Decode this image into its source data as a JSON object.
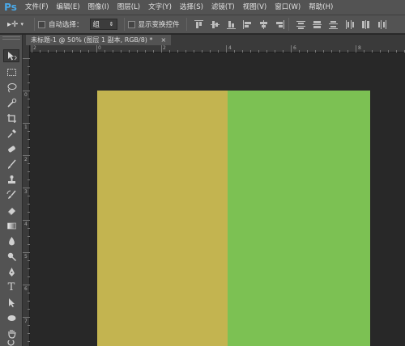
{
  "app": {
    "logo": "Ps",
    "menu": [
      "文件(F)",
      "编辑(E)",
      "图像(I)",
      "图层(L)",
      "文字(Y)",
      "选择(S)",
      "滤镜(T)",
      "视图(V)",
      "窗口(W)",
      "帮助(H)"
    ]
  },
  "options": {
    "auto_select_label": "自动选择：",
    "auto_select_value": "组",
    "show_transform_label": "显示变换控件"
  },
  "document": {
    "tab_title": "未标题-1 @ 50% (图层 1 副本, RGB/8) *",
    "tab_close": "×"
  },
  "rulers": {
    "horizontal": [
      "2",
      "0",
      "2",
      "4",
      "6",
      "8"
    ],
    "vertical": [
      "0",
      "1",
      "2",
      "3",
      "4",
      "5",
      "6",
      "7"
    ]
  },
  "colors": {
    "left_layer": "#c3b450",
    "right_layer": "#7cc153",
    "pasteboard": "#282828",
    "chrome": "#535353"
  }
}
